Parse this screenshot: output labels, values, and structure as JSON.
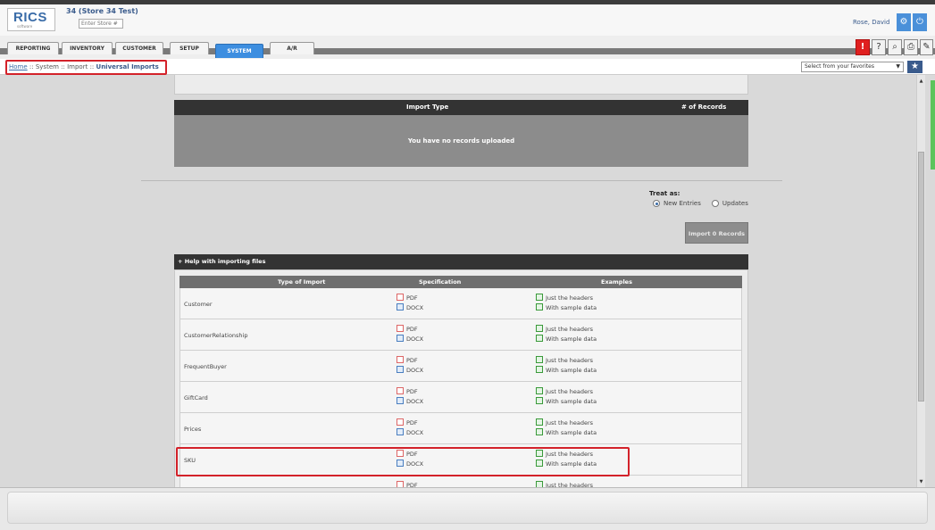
{
  "header": {
    "logo_text": "RICS",
    "logo_sub": "software",
    "store_name": "34 (Store 34 Test)",
    "store_placeholder": "Enter Store #",
    "user": "Rose, David"
  },
  "nav": {
    "tabs": [
      {
        "label": "REPORTING"
      },
      {
        "label": "INVENTORY"
      },
      {
        "label": "CUSTOMER"
      },
      {
        "label": "SETUP"
      },
      {
        "label": "SYSTEM",
        "active": true
      },
      {
        "label": "A/R"
      }
    ],
    "tool_icons": [
      "alert-icon",
      "help-icon",
      "search-icon",
      "print-icon",
      "tools-icon"
    ]
  },
  "breadcrumb": {
    "home": "Home",
    "sep1": " :: System :: Import :: ",
    "current": "Universal Imports"
  },
  "favorites": {
    "placeholder": "Select from your favorites"
  },
  "imports": {
    "col_type": "Import Type",
    "col_records": "# of Records",
    "empty": "You have no records uploaded"
  },
  "treat": {
    "label": "Treat as:",
    "opt_new": "New Entries",
    "opt_updates": "Updates",
    "selected": "New Entries"
  },
  "import_button": "Import 0 Records",
  "help": {
    "title": "+ Help with importing files",
    "col_type": "Type of Import",
    "col_spec": "Specification",
    "col_examples": "Examples",
    "spec_pdf": "PDF",
    "spec_docx": "DOCX",
    "ex_headers": "Just the headers",
    "ex_sample": "With sample data",
    "rows": [
      {
        "name": "Customer"
      },
      {
        "name": "CustomerRelationship"
      },
      {
        "name": "FrequentBuyer"
      },
      {
        "name": "GiftCard"
      },
      {
        "name": "Prices"
      },
      {
        "name": "SKU"
      },
      {
        "name": ""
      }
    ]
  },
  "colors": {
    "accent": "#3d8ee0",
    "highlight": "#d3222a",
    "dark_header": "#333333"
  }
}
